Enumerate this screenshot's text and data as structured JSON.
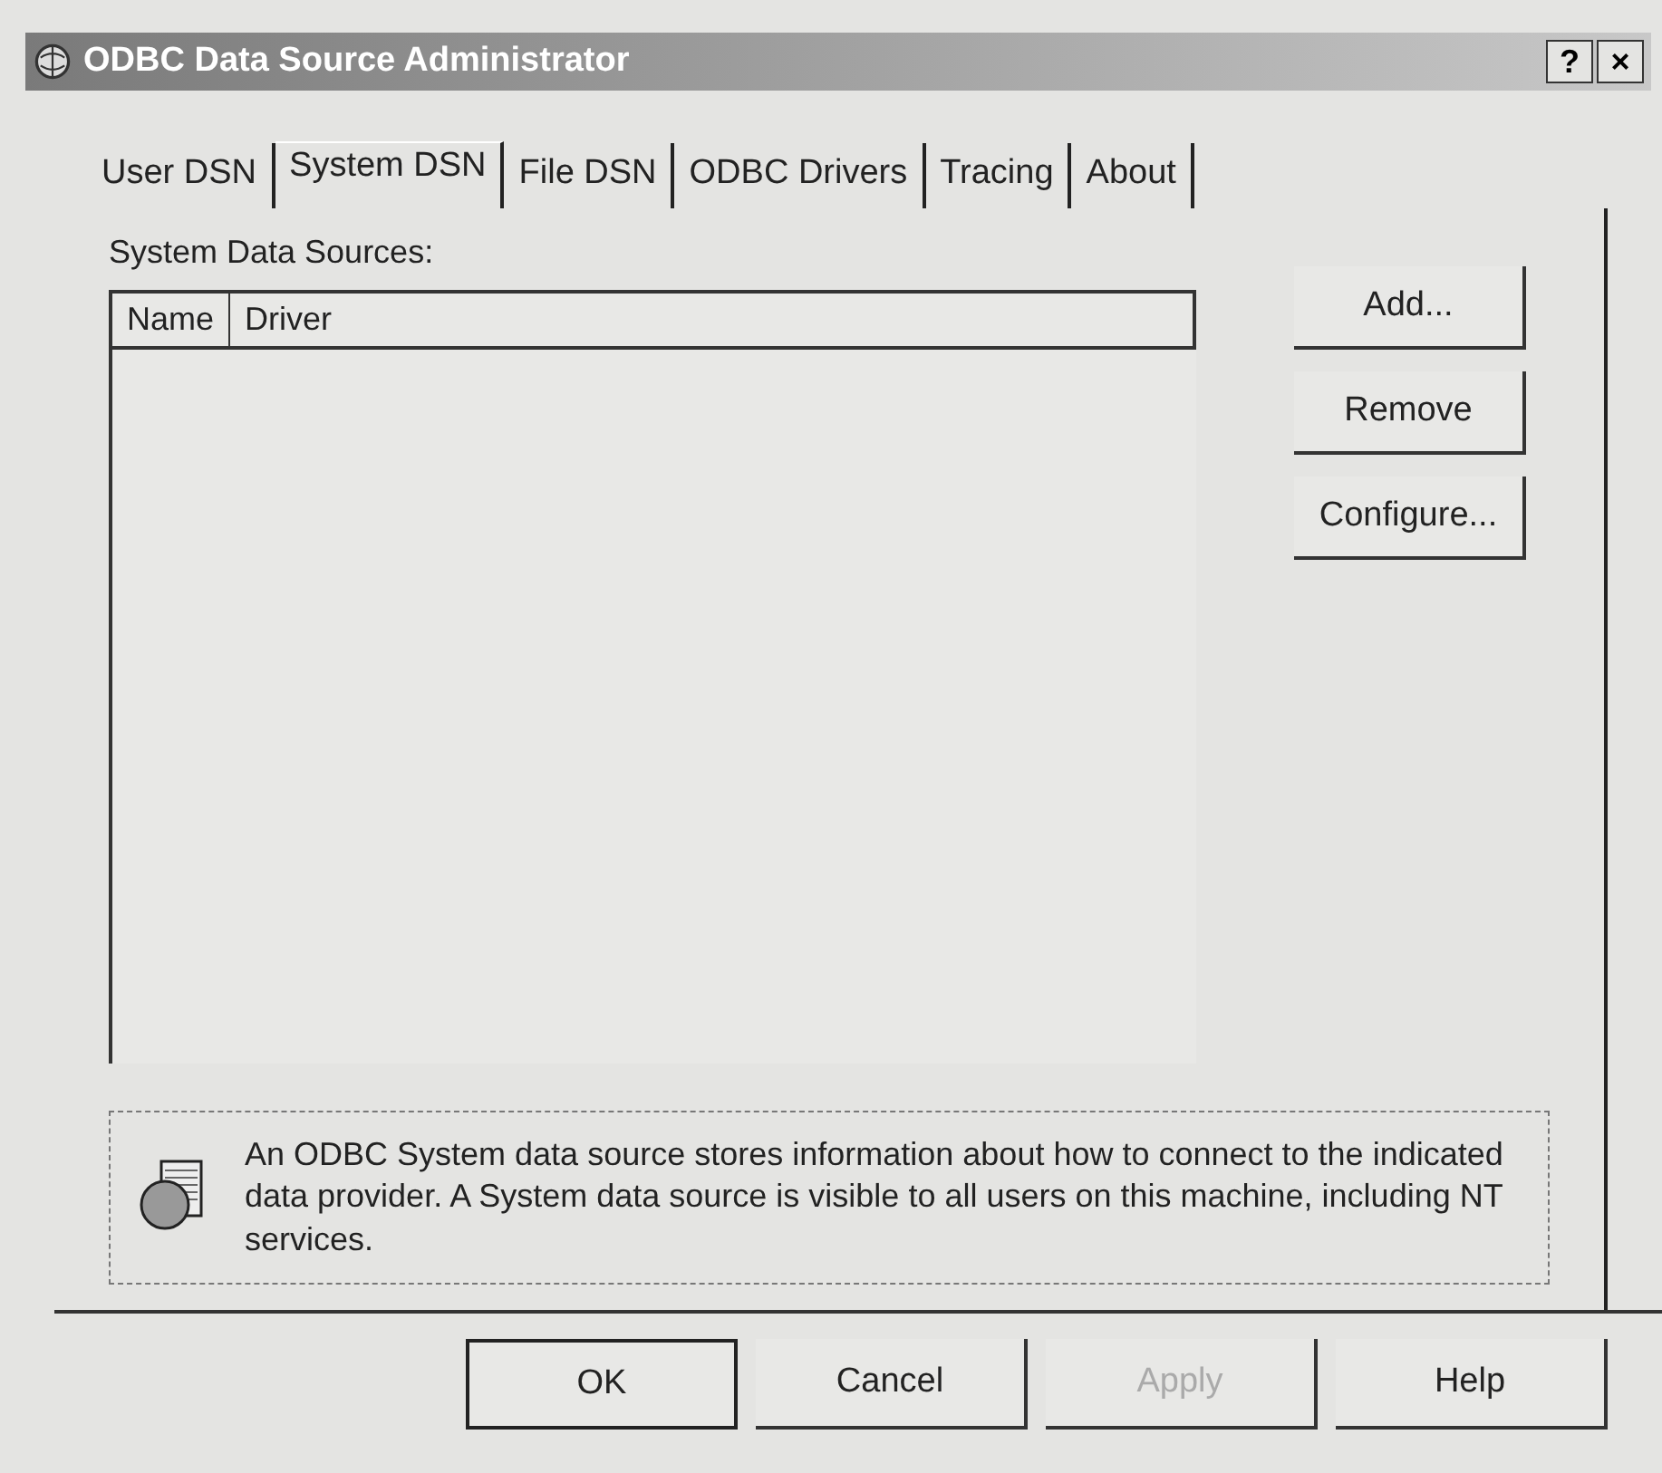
{
  "window": {
    "title": "ODBC Data Source Administrator",
    "title_buttons": [
      "?",
      "×"
    ]
  },
  "tabs": [
    {
      "label": "User DSN",
      "selected": false
    },
    {
      "label": "System DSN",
      "selected": true
    },
    {
      "label": "File DSN",
      "selected": false
    },
    {
      "label": "ODBC Drivers",
      "selected": false
    },
    {
      "label": "Tracing",
      "selected": false
    },
    {
      "label": "About",
      "selected": false
    }
  ],
  "list": {
    "label": "System Data Sources:",
    "columns": [
      "Name",
      "Driver"
    ]
  },
  "side_buttons": [
    {
      "label": "Add...",
      "disabled": false
    },
    {
      "label": "Remove",
      "disabled": false
    },
    {
      "label": "Configure...",
      "disabled": false
    }
  ],
  "info": {
    "text": "An ODBC System data source stores information about how to connect to the indicated data provider.   A System data source is visible to all users on this machine, including NT services."
  },
  "buttons": [
    {
      "label": "OK",
      "default": true,
      "disabled": false
    },
    {
      "label": "Cancel",
      "default": false,
      "disabled": false
    },
    {
      "label": "Apply",
      "default": false,
      "disabled": true
    },
    {
      "label": "Help",
      "default": false,
      "disabled": false
    }
  ]
}
